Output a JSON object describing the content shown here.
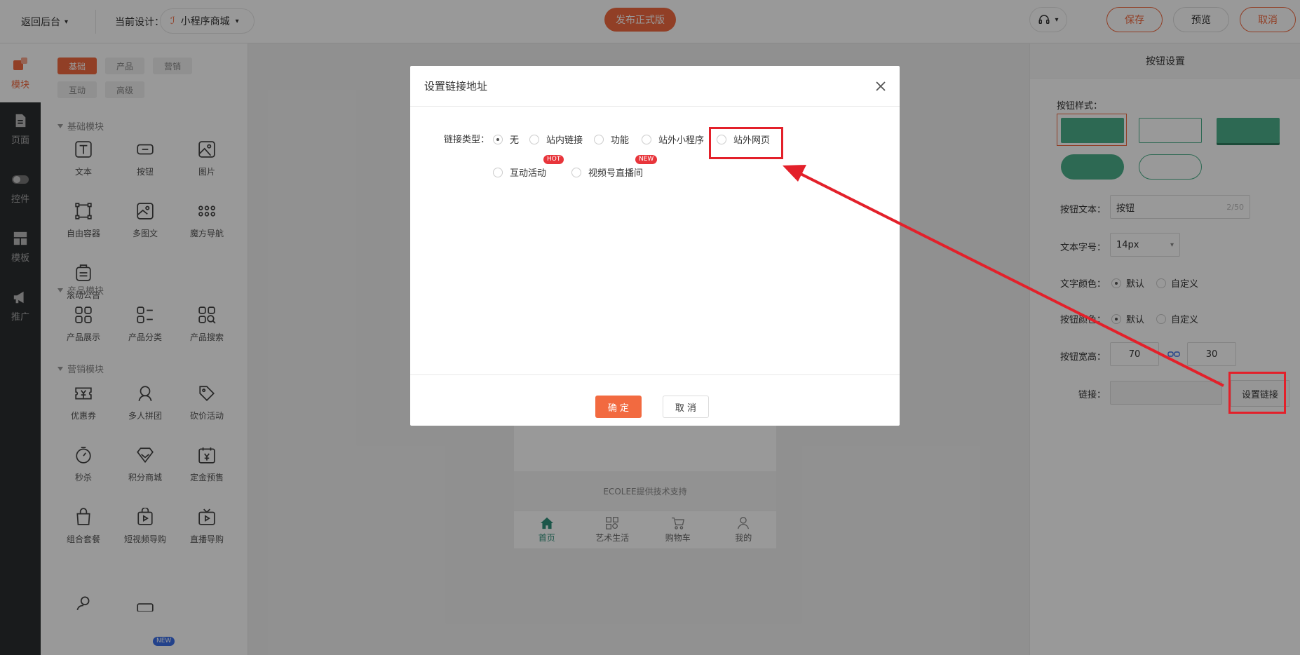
{
  "topbar": {
    "back_label": "返回后台",
    "design_label": "当前设计：",
    "design_name": "小程序商城",
    "publish_label": "发布正式版",
    "save_label": "保存",
    "preview_label": "预览",
    "cancel_label": "取消"
  },
  "rail": {
    "items": [
      {
        "label": "模块"
      },
      {
        "label": "页面"
      },
      {
        "label": "控件"
      },
      {
        "label": "模板"
      },
      {
        "label": "推广"
      }
    ]
  },
  "module_panel": {
    "tabs": [
      "基础",
      "产品",
      "营销",
      "互动",
      "高级"
    ],
    "sections": [
      {
        "title": "基础模块",
        "items": [
          "文本",
          "按钮",
          "图片",
          "自由容器",
          "多图文",
          "魔方导航",
          "滚动公告"
        ]
      },
      {
        "title": "产品模块",
        "items": [
          "产品展示",
          "产品分类",
          "产品搜索"
        ]
      },
      {
        "title": "营销模块",
        "items": [
          "优惠券",
          "多人拼团",
          "砍价活动",
          "秒杀",
          "积分商城",
          "定金预售",
          "组合套餐",
          "短视频导购",
          "直播导购"
        ]
      }
    ],
    "new_badge": "NEW"
  },
  "phone": {
    "footer_text": "ECOLEE提供技术支持",
    "tabs": [
      "首页",
      "艺术生活",
      "购物车",
      "我的"
    ]
  },
  "right_panel": {
    "title": "按钮设置",
    "style_label": "按钮样式：",
    "text_label": "按钮文本：",
    "text_value": "按钮",
    "text_count": "2/50",
    "font_size_label": "文本字号：",
    "font_size_value": "14px",
    "text_color_label": "文字颜色：",
    "btn_color_label": "按钮颜色：",
    "default_label": "默认",
    "custom_label": "自定义",
    "size_label": "按钮宽高：",
    "width_value": "70",
    "height_value": "30",
    "link_label": "链接：",
    "set_link_label": "设置链接"
  },
  "modal": {
    "title": "设置链接地址",
    "link_type_label": "链接类型：",
    "options": [
      "无",
      "站内链接",
      "功能",
      "站外小程序",
      "站外网页",
      "互动活动",
      "视频号直播间"
    ],
    "hot_badge": "HOT",
    "new_badge": "NEW",
    "confirm_label": "确 定",
    "cancel_label": "取 消"
  },
  "colors": {
    "accent": "#f26a40",
    "button_green": "#4caf8a",
    "highlight": "#e3202a",
    "rail_bg": "#2a2d30"
  }
}
